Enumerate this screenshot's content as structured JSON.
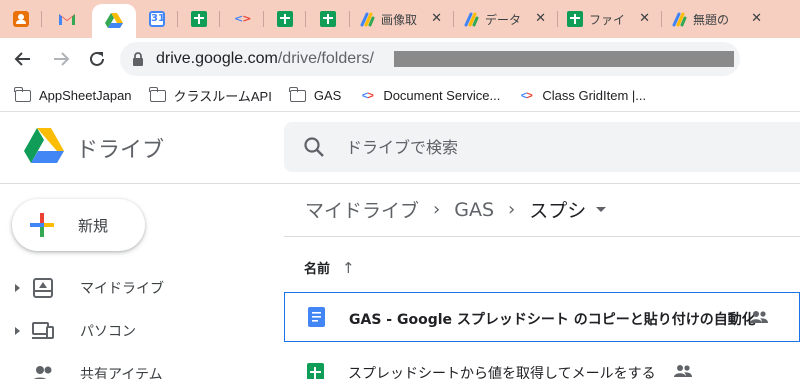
{
  "browser": {
    "tabs": [
      {
        "icon": "contacts-icon",
        "title": ""
      },
      {
        "icon": "gmail-icon",
        "title": ""
      },
      {
        "icon": "drive-icon",
        "title": "",
        "active": true
      },
      {
        "icon": "calendar-icon",
        "title": "",
        "badge": "31"
      },
      {
        "icon": "sheets-icon",
        "title": ""
      },
      {
        "icon": "code-icon",
        "title": ""
      },
      {
        "icon": "sheets-icon",
        "title": ""
      },
      {
        "icon": "sheets-icon",
        "title": ""
      },
      {
        "icon": "apps-script-icon",
        "title": "画像取"
      },
      {
        "icon": "apps-script-icon",
        "title": "データ"
      },
      {
        "icon": "sheets-icon",
        "title": "ファイ"
      },
      {
        "icon": "apps-script-icon",
        "title": "無題の"
      }
    ],
    "url_host": "drive.google.com",
    "url_path": "/drive/folders/",
    "bookmarks": [
      {
        "icon": "folder-icon",
        "label": "AppSheetJapan"
      },
      {
        "icon": "folder-icon",
        "label": "クラスルームAPI"
      },
      {
        "icon": "folder-icon",
        "label": "GAS"
      },
      {
        "icon": "code-icon",
        "label": "Document Service..."
      },
      {
        "icon": "code-icon",
        "label": "Class GridItem  |..."
      }
    ]
  },
  "drive": {
    "product_name": "ドライブ",
    "search_placeholder": "ドライブで検索",
    "new_button": "新規",
    "sidebar": [
      {
        "label": "マイドライブ",
        "icon": "my-drive-icon"
      },
      {
        "label": "パソコン",
        "icon": "computers-icon"
      },
      {
        "label": "共有アイテム",
        "icon": "shared-icon"
      }
    ],
    "breadcrumb": [
      "マイドライブ",
      "GAS",
      "スプシ"
    ],
    "column_name": "名前",
    "files": [
      {
        "name": "GAS - Google スプレッドシート のコピーと貼り付けの自動化",
        "type": "doc",
        "shared": true,
        "selected": true
      },
      {
        "name": "スプレッドシートから値を取得してメールをする",
        "type": "sheet",
        "shared": true,
        "selected": false
      }
    ]
  },
  "colors": {
    "tabstrip": "#f7cfc1",
    "accent": "#1a73e8",
    "doc_blue": "#4285f4",
    "sheet_green": "#0f9d58"
  }
}
